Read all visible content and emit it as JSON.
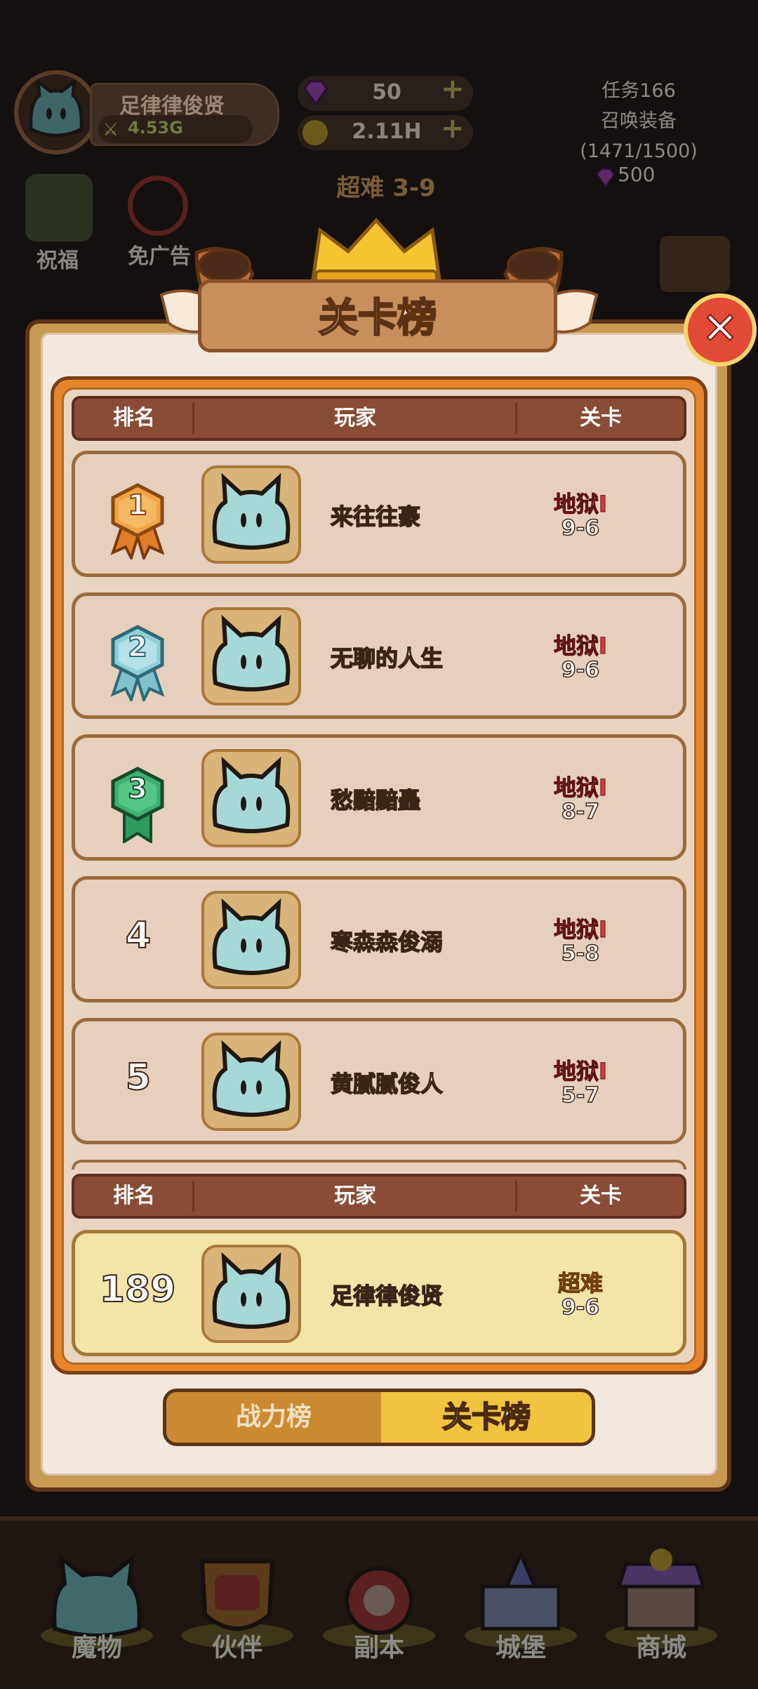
{
  "hud": {
    "player_name": "足律律俊贤",
    "power": "4.53G",
    "gems": "50",
    "gold": "2.11H",
    "plus_symbol": "+",
    "difficulty_title": "超难 3-9",
    "task_title": "任务166",
    "task_name": "召唤装备",
    "task_progress": "(1471/1500)",
    "task_reward": "500",
    "bless_label": "祝福",
    "noads_label": "免广告"
  },
  "modal": {
    "title": "关卡榜",
    "close_symbol": "✕",
    "columns": {
      "rank": "排名",
      "player": "玩家",
      "stage": "关卡"
    },
    "rows": [
      {
        "rank": "1",
        "name": "来往往豪",
        "difficulty": "地狱I",
        "level": "9-6"
      },
      {
        "rank": "2",
        "name": "无聊的人生",
        "difficulty": "地狱I",
        "level": "9-6"
      },
      {
        "rank": "3",
        "name": "愁黯黯矗",
        "difficulty": "地狱I",
        "level": "8-7"
      },
      {
        "rank": "4",
        "name": "寒森森俊溺",
        "difficulty": "地狱I",
        "level": "5-8"
      },
      {
        "rank": "5",
        "name": "黄腻腻俊人",
        "difficulty": "地狱I",
        "level": "5-7"
      }
    ],
    "me": {
      "rank": "189",
      "name": "足律律俊贤",
      "difficulty": "超难",
      "level": "9-6"
    },
    "tabs": {
      "power": "战力榜",
      "stage": "关卡榜"
    }
  },
  "nav": {
    "items": [
      "魔物",
      "伙伴",
      "副本",
      "城堡",
      "商城"
    ]
  },
  "colors": {
    "hell": "#d53d3d",
    "super_hard": "#e4862a",
    "active_tab": "#f2c33f",
    "my_row": "#f3e4a8",
    "cat_body": "#a7d8d8"
  }
}
